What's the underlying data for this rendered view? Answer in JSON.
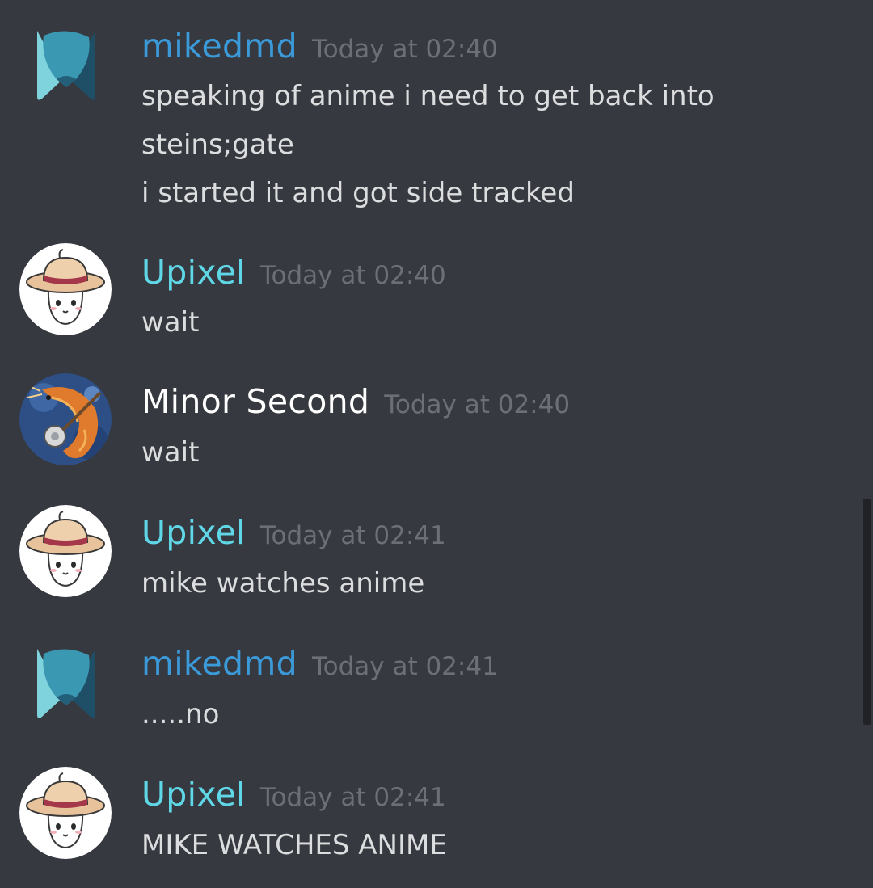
{
  "colors": {
    "background": "#36393f",
    "mikedmd_name": "#3b9ad9",
    "upixel_name": "#5fd7e6",
    "minor_second_name": "#ffffff",
    "message_text": "#dcddde",
    "timestamp": "#6c6f75"
  },
  "messages": [
    {
      "avatar_icon": "mikedmd-logo-icon",
      "username": "mikedmd",
      "timestamp": "Today at 02:40",
      "lines": [
        "speaking of anime i need to get back into",
        "steins;gate",
        "i started it and got side tracked"
      ]
    },
    {
      "avatar_icon": "straw-hat-boy-avatar-icon",
      "username": "Upixel",
      "timestamp": "Today at 02:40",
      "lines": [
        "wait"
      ]
    },
    {
      "avatar_icon": "shrimp-banjo-avatar-icon",
      "username": "Minor Second",
      "timestamp": "Today at 02:40",
      "lines": [
        "wait"
      ]
    },
    {
      "avatar_icon": "straw-hat-boy-avatar-icon",
      "username": "Upixel",
      "timestamp": "Today at 02:41",
      "lines": [
        "mike watches anime"
      ]
    },
    {
      "avatar_icon": "mikedmd-logo-icon",
      "username": "mikedmd",
      "timestamp": "Today at 02:41",
      "lines": [
        ".....no"
      ]
    },
    {
      "avatar_icon": "straw-hat-boy-avatar-icon",
      "username": "Upixel",
      "timestamp": "Today at 02:41",
      "lines": [
        "MIKE WATCHES ANIME"
      ]
    }
  ]
}
